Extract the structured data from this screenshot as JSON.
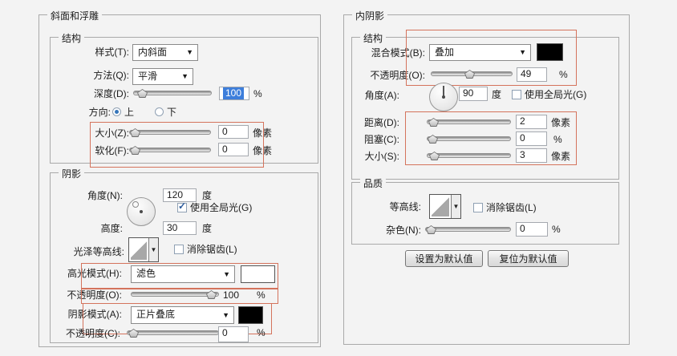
{
  "icons": {
    "dropdown_arrow": "▼",
    "check": "✓"
  },
  "colors": {
    "annotation": "#d4735c",
    "selection_bg": "#3d7edb",
    "swatch_black": "#000000",
    "swatch_white": "#ffffff"
  },
  "bevel": {
    "title": "斜面和浮雕",
    "structure": {
      "legend": "结构",
      "style": {
        "label": "样式(T):",
        "value": "内斜面"
      },
      "method": {
        "label": "方法(Q):",
        "value": "平滑"
      },
      "depth": {
        "label": "深度(D):",
        "value": "100",
        "unit": "%"
      },
      "direction": {
        "label": "方向:",
        "up": "上",
        "down": "下"
      },
      "size": {
        "label": "大小(Z):",
        "value": "0",
        "unit": "像素"
      },
      "soften": {
        "label": "软化(F):",
        "value": "0",
        "unit": "像素"
      }
    },
    "shading": {
      "legend": "阴影",
      "angle": {
        "label": "角度(N):",
        "value": "120",
        "unit": "度"
      },
      "use_global_light": "使用全局光(G)",
      "altitude": {
        "label": "高度:",
        "value": "30",
        "unit": "度"
      },
      "gloss_contour_label": "光泽等高线:",
      "anti_alias": "消除锯齿(L)",
      "highlight_mode": {
        "label": "高光模式(H):",
        "value": "滤色"
      },
      "highlight_opacity": {
        "label": "不透明度(O):",
        "value": "100",
        "unit": "%"
      },
      "shadow_mode": {
        "label": "阴影模式(A):",
        "value": "正片叠底"
      },
      "shadow_opacity": {
        "label": "不透明度(C):",
        "value": "0",
        "unit": "%"
      }
    }
  },
  "inner_shadow": {
    "title": "内阴影",
    "structure": {
      "legend": "结构",
      "blend_mode": {
        "label": "混合模式(B):",
        "value": "叠加"
      },
      "opacity": {
        "label": "不透明度(O):",
        "value": "49",
        "unit": "%"
      },
      "angle": {
        "label": "角度(A):",
        "value": "90",
        "unit": "度"
      },
      "use_global_light": "使用全局光(G)",
      "distance": {
        "label": "距离(D):",
        "value": "2",
        "unit": "像素"
      },
      "choke": {
        "label": "阻塞(C):",
        "value": "0",
        "unit": "%"
      },
      "size": {
        "label": "大小(S):",
        "value": "3",
        "unit": "像素"
      }
    },
    "quality": {
      "legend": "品质",
      "contour_label": "等高线:",
      "anti_alias": "消除锯齿(L)",
      "noise": {
        "label": "杂色(N):",
        "value": "0",
        "unit": "%"
      }
    },
    "buttons": {
      "set_default": "设置为默认值",
      "reset_default": "复位为默认值"
    }
  }
}
